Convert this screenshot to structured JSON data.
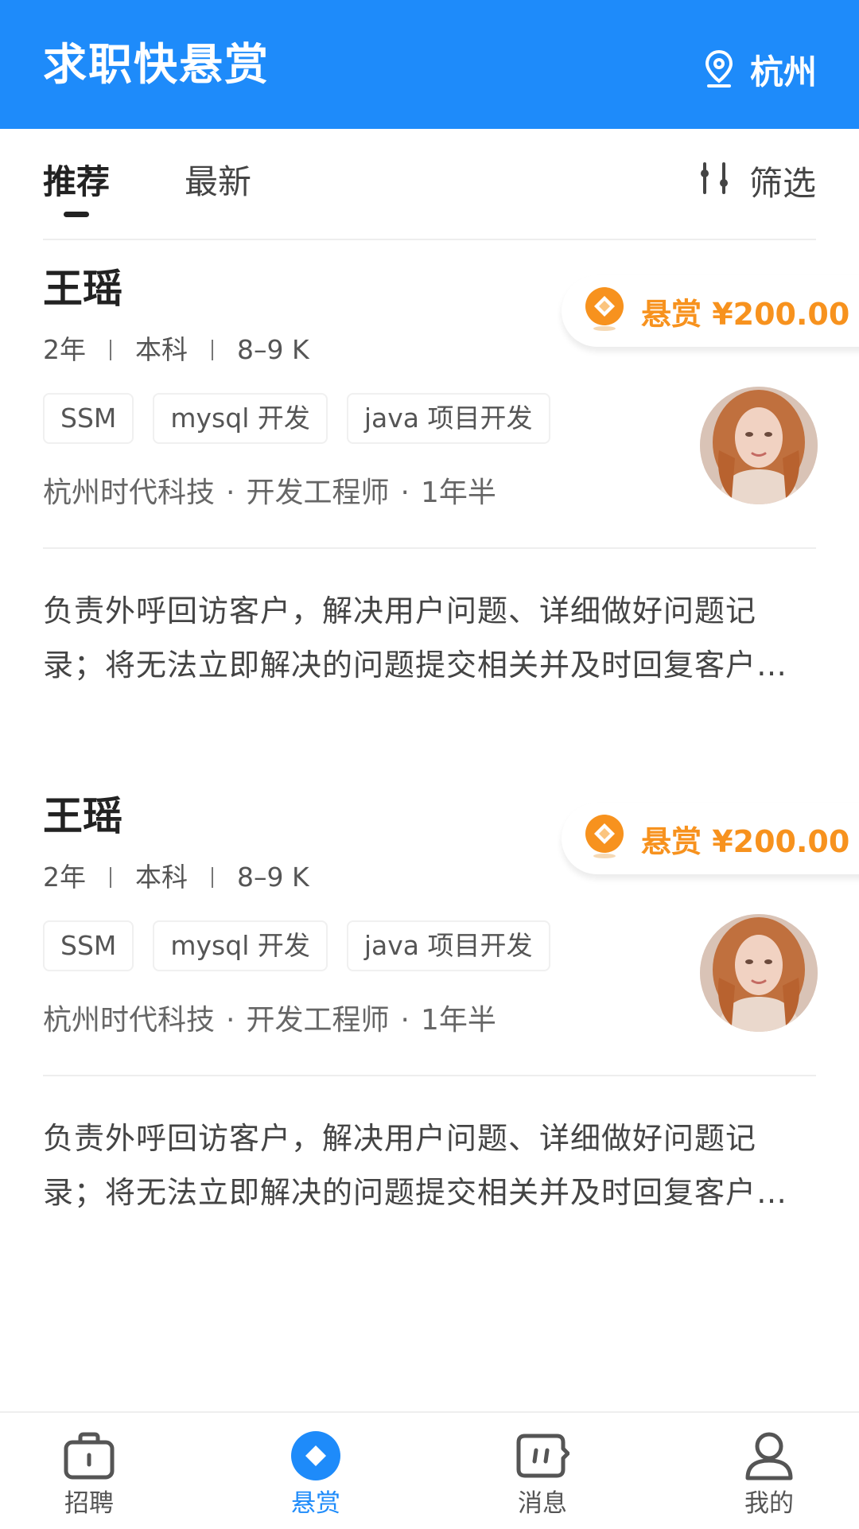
{
  "header": {
    "title": "求职快悬赏",
    "city": "杭州"
  },
  "tabs": {
    "items": [
      {
        "label": "推荐",
        "active": true
      },
      {
        "label": "最新",
        "active": false
      }
    ],
    "filter_label": "筛选"
  },
  "cards": [
    {
      "name": "王瑶",
      "experience": "2年",
      "education": "本科",
      "salary": "8–9 K",
      "tags": [
        "SSM",
        "mysql 开发",
        "java 项目开发"
      ],
      "company": "杭州时代科技",
      "position": "开发工程师",
      "tenure": "1年半",
      "reward": "悬赏 ¥200.00",
      "description": "负责外呼回访客户，解决用户问题、详细做好问题记录；将无法立即解决的问题提交相关并及时回复客户，跟进问题处理进度直至解决"
    },
    {
      "name": "王瑶",
      "experience": "2年",
      "education": "本科",
      "salary": "8–9 K",
      "tags": [
        "SSM",
        "mysql 开发",
        "java 项目开发"
      ],
      "company": "杭州时代科技",
      "position": "开发工程师",
      "tenure": "1年半",
      "reward": "悬赏 ¥200.00",
      "description": "负责外呼回访客户，解决用户问题、详细做好问题记录；将无法立即解决的问题提交相关并及时回复客户，跟进问题处理进度直至解决"
    }
  ],
  "bottom_nav": [
    {
      "label": "招聘",
      "icon": "briefcase-icon",
      "active": false
    },
    {
      "label": "悬赏",
      "icon": "reward-diamond-icon",
      "active": true
    },
    {
      "label": "消息",
      "icon": "message-icon",
      "active": false
    },
    {
      "label": "我的",
      "icon": "user-icon",
      "active": false
    }
  ],
  "colors": {
    "primary": "#1E8BFA",
    "reward": "#F7921E"
  }
}
